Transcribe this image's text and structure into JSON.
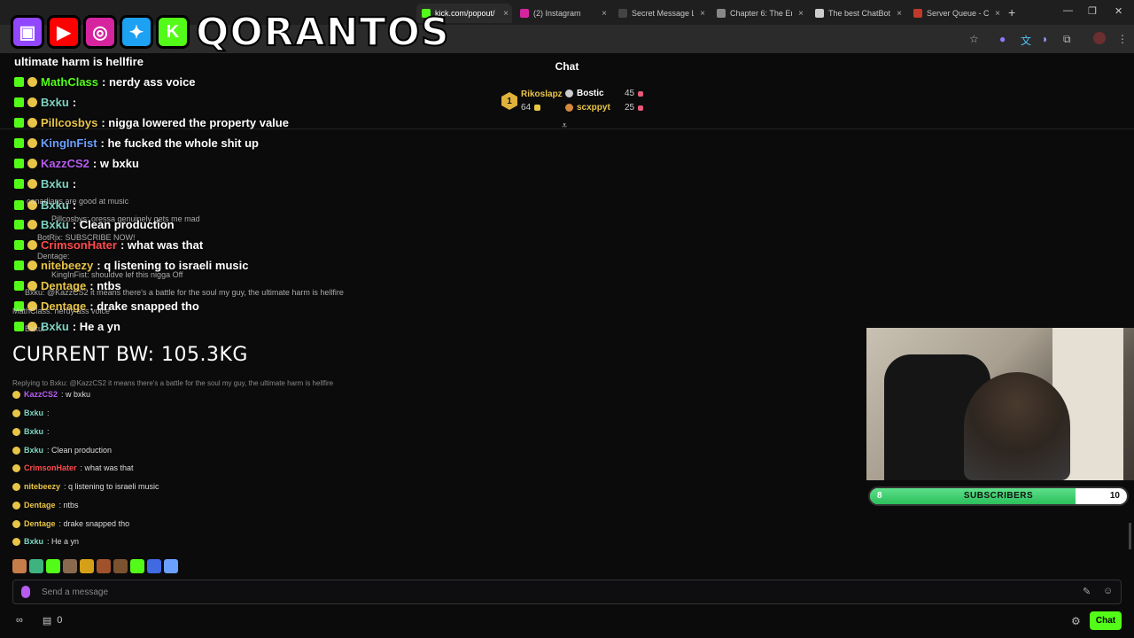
{
  "browser": {
    "tabs": [
      {
        "title": "kick.com/popout/",
        "color": "#53fc18",
        "active": true
      },
      {
        "title": "(2) Instagram",
        "color": "#d6249f",
        "active": false
      },
      {
        "title": "Secret Message L...",
        "color": "#444",
        "active": false
      },
      {
        "title": "Chapter 6: The En",
        "color": "#888",
        "active": false
      },
      {
        "title": "The best ChatBot",
        "color": "#ccc",
        "active": false
      },
      {
        "title": "Server Queue - C",
        "color": "#c0392b",
        "active": false
      }
    ],
    "new_tab": "+",
    "close_glyph": "×"
  },
  "brand": {
    "name": "QORANTOS",
    "icons": [
      {
        "name": "twitch-icon",
        "color": "#9146ff",
        "glyph": "▣"
      },
      {
        "name": "youtube-icon",
        "color": "#ff0000",
        "glyph": "▶"
      },
      {
        "name": "instagram-icon",
        "color": "#d6249f",
        "glyph": "◎"
      },
      {
        "name": "twitter-icon",
        "color": "#1da1f2",
        "glyph": "✦"
      },
      {
        "name": "kick-icon",
        "color": "#53fc18",
        "glyph": "K"
      }
    ]
  },
  "chat": {
    "title": "Chat",
    "leaderboard": {
      "rank": "1",
      "first": {
        "name": "Rikoslapz",
        "amount": "64"
      },
      "entries": [
        {
          "name": "Bostic",
          "amount": "45"
        },
        {
          "name": "scxppyt",
          "amount": "25"
        }
      ]
    }
  },
  "overlay_messages": [
    {
      "user": "",
      "text": "ultimate harm is hellfire",
      "color": "#fff"
    },
    {
      "user": "MathClass",
      "text": ": nerdy ass voice",
      "color": "#53fc18"
    },
    {
      "user": "Bxku",
      "text": ":",
      "color": "#7dd3c0"
    },
    {
      "user": "Pillcosbys",
      "text": ": nigga lowered the property value",
      "color": "#e8c547"
    },
    {
      "user": "KingInFist",
      "text": ": he fucked the whole shit up",
      "color": "#6aa0ff"
    },
    {
      "user": "KazzCS2",
      "text": ": w bxku",
      "color": "#b65cf0"
    },
    {
      "user": "Bxku",
      "text": ":",
      "color": "#7dd3c0"
    },
    {
      "user": "Bxku",
      "text": ":",
      "color": "#7dd3c0"
    },
    {
      "user": "Bxku",
      "text": ": Clean production",
      "color": "#7dd3c0"
    },
    {
      "user": "CrimsonHater",
      "text": ": what was that",
      "color": "#ff4b4b"
    },
    {
      "user": "nitebeezy",
      "text": ": q listening to israeli music",
      "color": "#e8c547"
    },
    {
      "user": "Dentage",
      "text": ": ntbs",
      "color": "#e8c547"
    },
    {
      "user": "Dentage",
      "text": ": drake snapped tho",
      "color": "#e8c547"
    },
    {
      "user": "Bxku",
      "text": ": He a yn",
      "color": "#7dd3c0"
    }
  ],
  "faint_messages": [
    "canadians are good at music",
    "Pillcosbys: oressa genuinely gets me mad",
    "BotRix: SUBSCRIBE NOW!",
    "Dentage:",
    "KingInFist: shouldve lef this nigga Off",
    "Bxku: @KazzCS2 it means there's a battle for the soul my guy, the ultimate harm is hellfire",
    "MathClass: nerdy ass voice",
    "Bxku:"
  ],
  "bodyweight": "CURRENT BW: 105.3KG",
  "messages": [
    {
      "user": "",
      "text": "Replying to Bxku: @KazzCS2 it means there's a battle for the soul my guy, the ultimate harm is hellfire",
      "color": "#888"
    },
    {
      "user": "KazzCS2",
      "text": ": w bxku",
      "color": "#b65cf0"
    },
    {
      "user": "Bxku",
      "text": ":",
      "color": "#7dd3c0"
    },
    {
      "user": "Bxku",
      "text": ":",
      "color": "#7dd3c0"
    },
    {
      "user": "Bxku",
      "text": ": Clean production",
      "color": "#7dd3c0"
    },
    {
      "user": "CrimsonHater",
      "text": ": what was that",
      "color": "#ff4b4b"
    },
    {
      "user": "nitebeezy",
      "text": ": q listening to israeli music",
      "color": "#e8c547"
    },
    {
      "user": "Dentage",
      "text": ": ntbs",
      "color": "#e8c547"
    },
    {
      "user": "Dentage",
      "text": ": drake snapped tho",
      "color": "#e8c547"
    },
    {
      "user": "Bxku",
      "text": ": He a yn",
      "color": "#7dd3c0"
    }
  ],
  "emotes": [
    "#c77d4a",
    "#3fb37f",
    "#53fc18",
    "#8a6a4f",
    "#d4a017",
    "#a0522d",
    "#7a5230",
    "#53fc18",
    "#4169e1",
    "#6aa0ff"
  ],
  "input": {
    "placeholder": "Send a message"
  },
  "footer": {
    "viewers": "0",
    "chat_button": "Chat"
  },
  "subgoal": {
    "label": "SUBSCRIBERS",
    "current": "8",
    "goal": "10",
    "progress": 0.8
  }
}
